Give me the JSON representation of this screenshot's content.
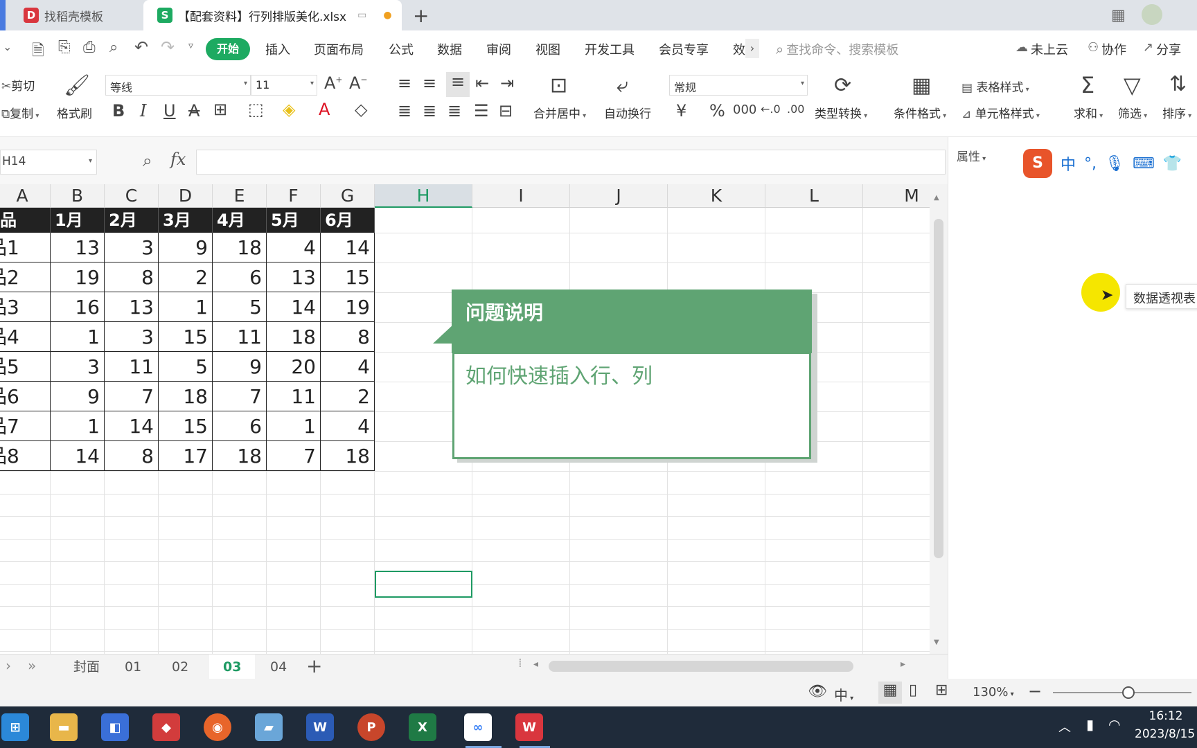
{
  "tabs": [
    {
      "label": "找稻壳模板"
    },
    {
      "label": "【配套资料】行列排版美化.xlsx"
    }
  ],
  "menu": {
    "start": "开始",
    "items": [
      "插入",
      "页面布局",
      "公式",
      "数据",
      "审阅",
      "视图",
      "开发工具",
      "会员专享",
      "效"
    ],
    "search_placeholder": "查找命令、搜索模板",
    "cloud": "未上云",
    "collab": "协作",
    "share": "分享"
  },
  "ribbon": {
    "cut": "剪切",
    "copy": "复制",
    "format_painter": "格式刷",
    "font_name": "等线",
    "font_size": "11",
    "merge": "合并居中",
    "wrap": "自动换行",
    "number_format": "常规",
    "convert": "类型转换",
    "conditional": "条件格式",
    "table_style": "表格样式",
    "cell_style": "单元格样式",
    "sum": "求和",
    "filter": "筛选",
    "sort": "排序"
  },
  "formula": {
    "name_box": "H14",
    "fx": "fx"
  },
  "columns": [
    "A",
    "B",
    "C",
    "D",
    "E",
    "F",
    "G",
    "H",
    "I",
    "J",
    "K",
    "L",
    "M"
  ],
  "selected_column": "H",
  "table": {
    "headers": [
      "品",
      "1月",
      "2月",
      "3月",
      "4月",
      "5月",
      "6月"
    ],
    "rows": [
      {
        "name": "品1",
        "values": [
          13,
          3,
          9,
          18,
          4,
          14
        ]
      },
      {
        "name": "品2",
        "values": [
          19,
          8,
          2,
          6,
          13,
          15
        ]
      },
      {
        "name": "品3",
        "values": [
          16,
          13,
          1,
          5,
          14,
          19
        ]
      },
      {
        "name": "品4",
        "values": [
          1,
          3,
          15,
          11,
          18,
          8
        ]
      },
      {
        "name": "品5",
        "values": [
          3,
          11,
          5,
          9,
          20,
          4
        ]
      },
      {
        "name": "品6",
        "values": [
          9,
          7,
          18,
          7,
          11,
          2
        ]
      },
      {
        "name": "品7",
        "values": [
          1,
          14,
          15,
          6,
          1,
          4
        ]
      },
      {
        "name": "品8",
        "values": [
          14,
          8,
          17,
          18,
          7,
          18
        ]
      }
    ]
  },
  "note": {
    "title": "问题说明",
    "body": "如何快速插入行、列"
  },
  "panel": {
    "properties": "属性",
    "pivot_tooltip": "数据透视表"
  },
  "sheet_tabs": [
    "封面",
    "01",
    "02",
    "03",
    "04"
  ],
  "active_sheet": "03",
  "status": {
    "zoom": "130%",
    "ime": "中"
  },
  "clock": {
    "time": "16:12",
    "date": "2023/8/15"
  },
  "colors": {
    "accent_green": "#1daa61",
    "note_green": "#5fa473",
    "header_black": "#222222"
  }
}
